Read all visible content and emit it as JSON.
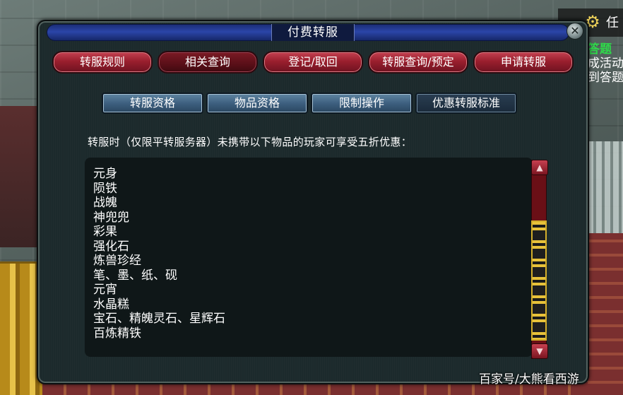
{
  "hud": {
    "gear_icon": "gear-icon",
    "label": "任"
  },
  "side_quest": {
    "line1": "答题",
    "line2": "成活动",
    "line3": "到答题"
  },
  "dialog": {
    "title": "付费转服",
    "close_symbol": "✕",
    "main_tabs": [
      {
        "label": "转服规则",
        "active": false
      },
      {
        "label": "相关查询",
        "active": true
      },
      {
        "label": "登记/取回",
        "active": false
      },
      {
        "label": "转服查询/预定",
        "active": false
      },
      {
        "label": "申请转服",
        "active": false
      }
    ],
    "sub_tabs": [
      {
        "label": "转服资格",
        "active": false
      },
      {
        "label": "物品资格",
        "active": false
      },
      {
        "label": "限制操作",
        "active": false
      },
      {
        "label": "优惠转服标准",
        "active": true
      }
    ],
    "notice": "转服时（仅限平转服务器）未携带以下物品的玩家可享受五折优惠：",
    "items": [
      "元身",
      "陨铁",
      "战魄",
      "神兜兜",
      "彩果",
      "强化石",
      "炼兽珍经",
      "笔、墨、纸、砚",
      "元宵",
      "水晶糕",
      "宝石、精魄灵石、星辉石",
      "百炼精铁"
    ],
    "scrollbar": {
      "up_symbol": "▲",
      "down_symbol": "▼"
    }
  },
  "watermark": "百家号/大熊看西游",
  "colors": {
    "red_tab": "#9a1f2e",
    "blue_tab": "#3e6080",
    "dialog_bg": "#1c2a2c",
    "title_bar": "#2b45a8",
    "quest_green": "#2fd84a",
    "scroll_gold": "#e8c23a"
  }
}
